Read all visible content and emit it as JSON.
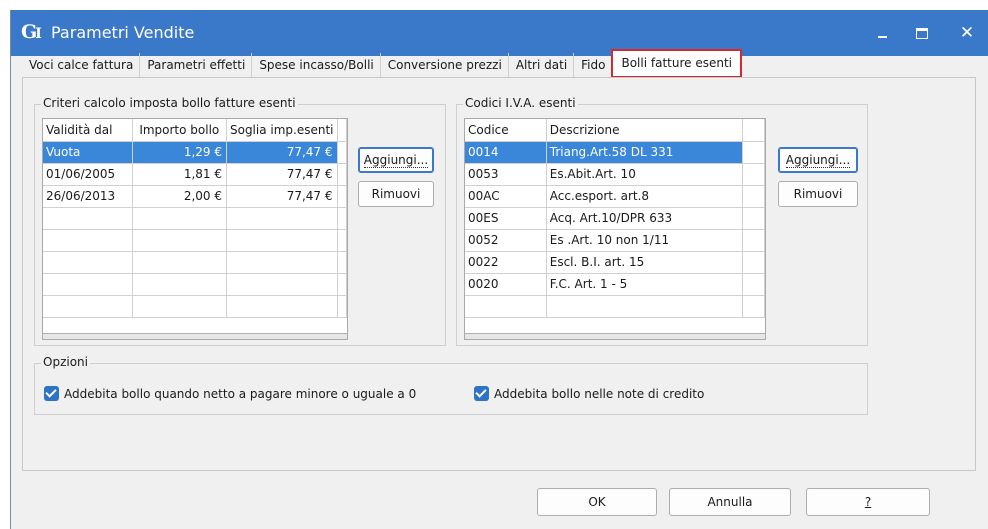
{
  "window": {
    "logo": "G",
    "logo_sub": "I",
    "title": "Parametri Vendite"
  },
  "tabs": [
    "Voci calce fattura",
    "Parametri effetti",
    "Spese incasso/Bolli",
    "Conversione prezzi",
    "Altri dati",
    "Fido",
    "Bolli fatture esenti"
  ],
  "active_tab": "Bolli fatture esenti",
  "criteri": {
    "group_label": "Criteri calcolo imposta bollo fatture esenti",
    "columns": [
      "Validità dal",
      "Importo bollo",
      "Soglia imp.esenti"
    ],
    "rows": [
      [
        "Vuota",
        "1,29 €",
        "77,47 €"
      ],
      [
        "01/06/2005",
        "1,81 €",
        "77,47 €"
      ],
      [
        "26/06/2013",
        "2,00 €",
        "77,47 €"
      ]
    ],
    "selected_row": 0,
    "add_label": "Aggiungi...",
    "remove_label": "Rimuovi"
  },
  "codici": {
    "group_label": "Codici I.V.A. esenti",
    "columns": [
      "Codice",
      "Descrizione"
    ],
    "rows": [
      [
        "0014",
        "Triang.Art.58 DL 331"
      ],
      [
        "0053",
        "Es.Abit.Art. 10"
      ],
      [
        "00AC",
        "Acc.esport. art.8"
      ],
      [
        "00ES",
        "Acq. Art.10/DPR 633"
      ],
      [
        "0052",
        "Es .Art. 10 non 1/11"
      ],
      [
        "0022",
        "Escl. B.I. art. 15"
      ],
      [
        "0020",
        "F.C. Art. 1 - 5"
      ]
    ],
    "selected_row": 0,
    "add_label": "Aggiungi...",
    "remove_label": "Rimuovi"
  },
  "opzioni": {
    "group_label": "Opzioni",
    "check1": "Addebita bollo quando netto a pagare minore o uguale a 0",
    "check2": "Addebita bollo nelle note di credito"
  },
  "footer": {
    "ok": "OK",
    "cancel": "Annulla",
    "help": "?"
  },
  "colors": {
    "titlebar": "#3a78c9",
    "selection": "#3a86d9",
    "active_tab_border": "#d6282f"
  }
}
